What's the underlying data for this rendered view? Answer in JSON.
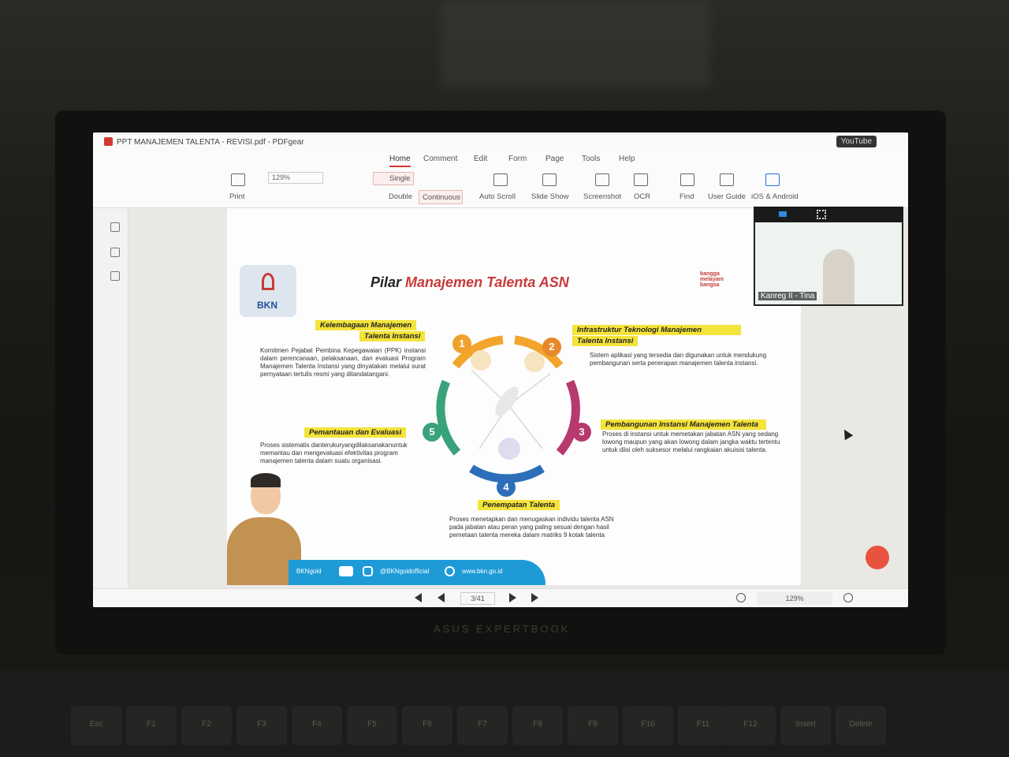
{
  "window": {
    "title": "PPT MANAJEMEN TALENTA - REVISI.pdf - PDFgear",
    "youtube_label": "YouTube"
  },
  "tabs": [
    "Home",
    "Comment",
    "Edit",
    "Form",
    "Page",
    "Tools",
    "Help"
  ],
  "toolbar": {
    "zoom_value": "129%",
    "print": "Print",
    "single": "Single",
    "double": "Double",
    "continuous": "Continuous",
    "auto_scroll": "Auto Scroll",
    "slide_show": "Slide Show",
    "screenshot": "Screenshot",
    "ocr": "OCR",
    "find": "Find",
    "user_guide": "User Guide",
    "ios_android": "iOS & Android"
  },
  "slide": {
    "title_prefix": "Pilar",
    "title_main": "Manajemen Talenta ASN",
    "logo_text": "BKN",
    "tagline": [
      "bangga",
      "melayani",
      "bangsa"
    ],
    "pillars": [
      {
        "num": "1",
        "title_line1": "Kelembagaan Manajemen",
        "title_line2": "Talenta Instansi",
        "text": "Komitmen Pejabat Pembina Kepegawaian (PPK) instansi dalam perencanaan, pelaksanaan, dan evaluasi Program Manajemen Talenta Instansi yang dinyatakan melalui surat pernyataan tertulis resmi yang ditandatangani."
      },
      {
        "num": "2",
        "title_line1": "Infrastruktur Teknologi Manajemen",
        "title_line2": "Talenta Instansi",
        "text": "Sistem aplikasi yang tersedia dan digunakan untuk mendukung pembangunan serta penerapan manajemen talenta instansi."
      },
      {
        "num": "3",
        "title_line1": "Pembangunan Instansi Manajemen Talenta",
        "title_line2": "",
        "text": "Proses di instansi untuk memetakan jabatan ASN yang sedang lowong maupun yang akan lowong dalam jangka waktu tertentu untuk diisi oleh suksesor melalui rangkaian akuisisi talenta."
      },
      {
        "num": "4",
        "title_line1": "Penempatan Talenta",
        "title_line2": "",
        "text": "Proses menetapkan dan menugaskan individu talenta ASN pada jabatan atau peran yang paling sesuai dengan hasil pemetaan talenta mereka dalam matriks 9 kotak talenta"
      },
      {
        "num": "5",
        "title_line1": "Pemantauan dan Evaluasi",
        "title_line2": "",
        "text": "Proses sistematis danterukuryangdilaksanakanuntuk memantau dan mengevaluasi efektivitas program manajemen talenta dalam suatu organisasi."
      }
    ],
    "footer": {
      "handle1": "BKNgoid",
      "handle2": "@BKNgoidofficial",
      "site": "www.bkn.go.id"
    }
  },
  "video": {
    "name": "Kanreg II - Tina"
  },
  "status": {
    "page": "3/41",
    "zoom": "129%"
  },
  "laptop": {
    "brand": "ASUS EXPERTBOOK"
  },
  "keys": [
    "Esc",
    "F1",
    "F2",
    "F3",
    "F4",
    "F5",
    "F6",
    "F7",
    "F8",
    "F9",
    "F10",
    "F11",
    "F12",
    "Insert",
    "Delete"
  ],
  "colors": {
    "accent": "#d23b2f",
    "highlight": "#f4e33a",
    "navy": "#1f3a6b"
  }
}
